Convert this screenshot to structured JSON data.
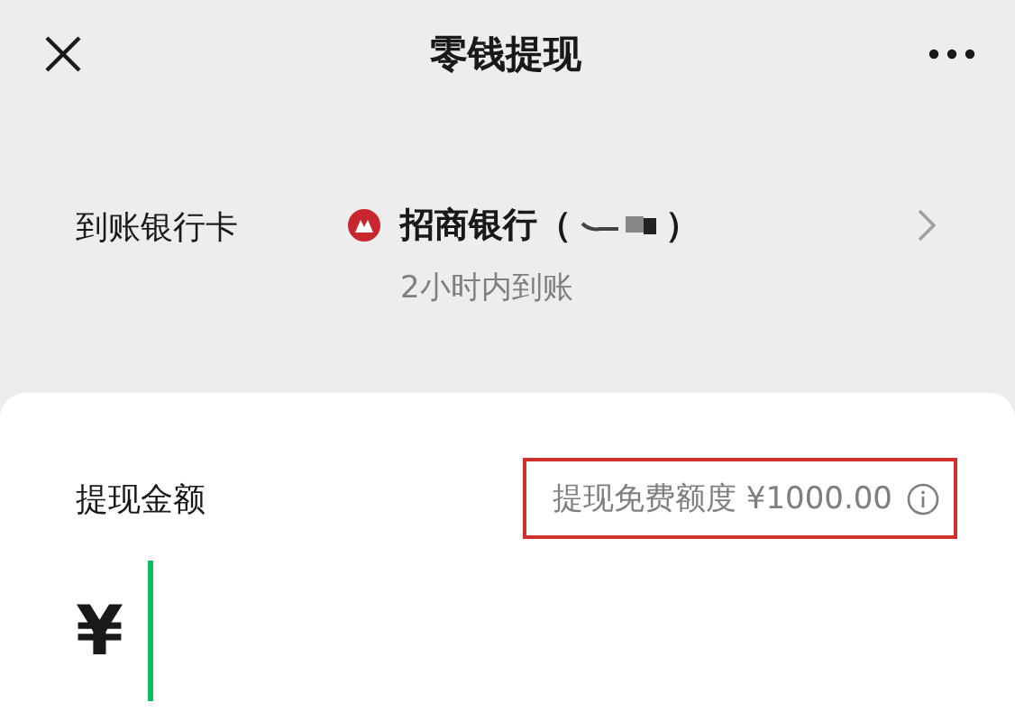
{
  "nav": {
    "title": "零钱提现"
  },
  "bank": {
    "label": "到账银行卡",
    "name_prefix": "招商银行（",
    "name_suffix": "）",
    "redacted": true,
    "arrival": "2小时内到账"
  },
  "amount": {
    "label": "提现金额",
    "quota": "提现免费额度 ¥1000.00",
    "quota_highlighted": true,
    "currency": "¥"
  }
}
